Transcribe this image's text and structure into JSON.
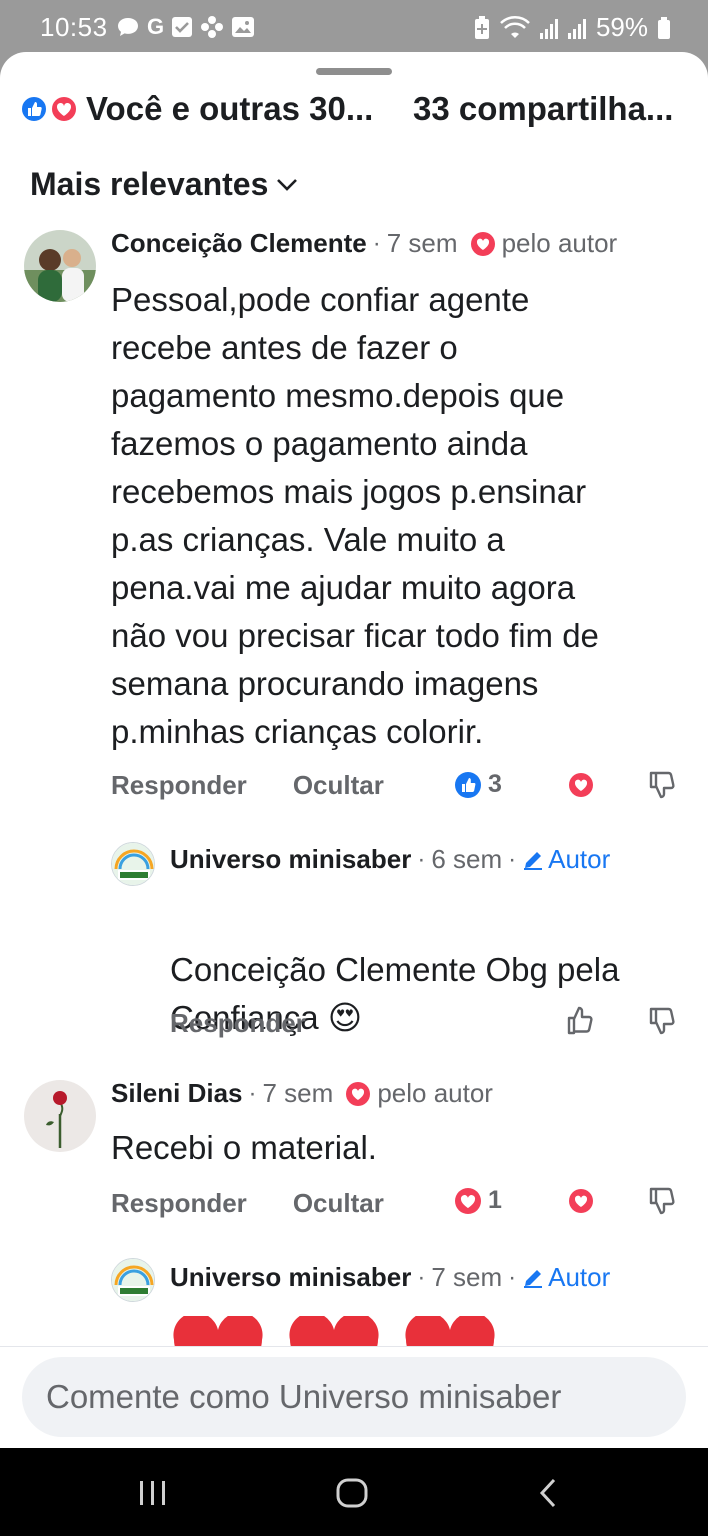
{
  "status_bar": {
    "time": "10:53",
    "left_icons": [
      "chat-icon",
      "google-icon",
      "checkbox-icon",
      "flower-icon",
      "image-icon"
    ],
    "battery": "59%"
  },
  "reactions_summary": {
    "text": "Você e outras 30...",
    "shares": "33 compartilha..."
  },
  "sort": {
    "label": "Mais relevantes"
  },
  "comments": [
    {
      "author": "Conceição Clemente",
      "time": "7 sem",
      "badge": "pelo autor",
      "lines": [
        "Pessoal,pode confiar agente",
        "recebe antes de fazer o",
        "pagamento mesmo.depois que",
        "fazemos o pagamento ainda",
        "recebemos mais jogos p.ensinar",
        "p.as crianças. Vale muito a",
        "pena.vai me ajudar muito agora",
        "não vou precisar ficar todo fim de",
        "semana procurando imagens",
        "p.minhas crianças colorir."
      ],
      "reply": "Responder",
      "hide": "Ocultar",
      "reaction_count": "3",
      "reply_comment": {
        "author": "Universo minisaber",
        "time": "6 sem",
        "tag": "Autor",
        "lines": [
          "Conceição Clemente Obg pela",
          "Confiança 😍"
        ],
        "reply": "Responder"
      }
    },
    {
      "author": "Sileni Dias",
      "time": "7 sem",
      "badge": "pelo autor",
      "lines": [
        "Recebi o material."
      ],
      "reply": "Responder",
      "hide": "Ocultar",
      "reaction_count": "1",
      "reply_comment": {
        "author": "Universo minisaber",
        "time": "7 sem",
        "tag": "Autor",
        "lines": [
          "❤️ ❤️ ❤️"
        ]
      }
    }
  ],
  "composer": {
    "placeholder": "Comente como Universo minisaber"
  },
  "colors": {
    "brand_blue": "#1877f2",
    "love_red": "#f33e58",
    "muted": "#65676b"
  }
}
